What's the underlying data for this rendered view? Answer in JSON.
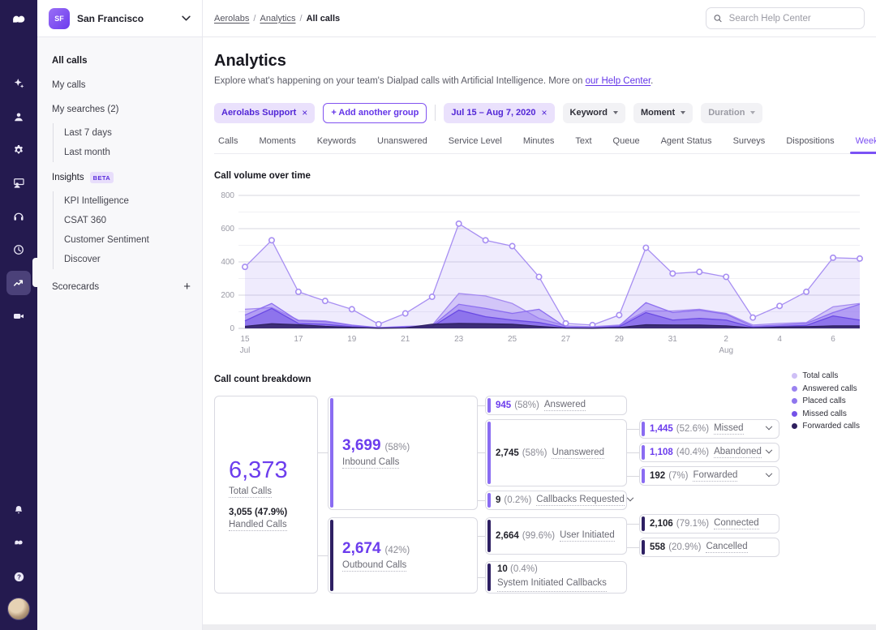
{
  "topbar": {
    "team_name": "San Francisco",
    "team_initials": "SF",
    "breadcrumb": [
      "Aerolabs",
      "Analytics",
      "All calls"
    ],
    "search_placeholder": "Search Help Center"
  },
  "rail": {
    "help_glyph": "?"
  },
  "sidebar": {
    "items_top": [
      "All calls",
      "My calls",
      "My searches (2)"
    ],
    "searches": [
      "Last 7 days",
      "Last month"
    ],
    "insights_label": "Insights",
    "beta_badge": "BETA",
    "insights_items": [
      "KPI Intelligence",
      "CSAT 360",
      "Customer Sentiment",
      "Discover"
    ],
    "scorecards_label": "Scorecards",
    "add_icon": "+"
  },
  "header": {
    "title": "Analytics",
    "description": "Explore what's happening on your team's Dialpad calls with Artificial Intelligence. More on",
    "link_text": "our Help Center",
    "period": "."
  },
  "filters": {
    "group_chip": "Aerolabs Support",
    "close": "×",
    "add_group": "+ Add another group",
    "date_chip": "Jul 15 – Aug 7, 2020",
    "keyword": "Keyword",
    "moment": "Moment",
    "duration": "Duration"
  },
  "tabs": {
    "items": [
      "Calls",
      "Moments",
      "Keywords",
      "Unanswered",
      "Service Level",
      "Minutes",
      "Text",
      "Queue",
      "Agent Status",
      "Surveys",
      "Dispositions",
      "Weekly Averages"
    ],
    "active": "Weekly Averages"
  },
  "chart_section": {
    "title": "Call volume over time"
  },
  "chart_data": {
    "type": "area",
    "title": "Call volume over time",
    "x": [
      15,
      16,
      17,
      18,
      19,
      20,
      21,
      22,
      23,
      24,
      25,
      26,
      27,
      28,
      29,
      30,
      31,
      1,
      2,
      3,
      4,
      5,
      6,
      7
    ],
    "month_labels": [
      {
        "index": 0,
        "label": "Jul"
      },
      {
        "index": 18,
        "label": "Aug"
      }
    ],
    "ylim": [
      0,
      800
    ],
    "yticks": [
      0,
      200,
      400,
      600,
      800
    ],
    "grid_step": 100,
    "legend_position": "right-of-breakdown",
    "series": [
      {
        "name": "Total calls",
        "color": "#a78ef2",
        "fill_opacity": 0.18,
        "markers": true,
        "values": [
          370,
          530,
          220,
          165,
          115,
          25,
          90,
          190,
          630,
          530,
          495,
          310,
          30,
          20,
          80,
          485,
          330,
          340,
          310,
          65,
          135,
          220,
          425,
          420
        ]
      },
      {
        "name": "Placed calls",
        "color": "#a48af0",
        "fill_opacity": 0.38,
        "markers": false,
        "values": [
          115,
          125,
          50,
          45,
          20,
          5,
          12,
          18,
          210,
          195,
          150,
          60,
          15,
          10,
          20,
          105,
          105,
          115,
          90,
          20,
          30,
          35,
          130,
          150
        ]
      },
      {
        "name": "Answered calls",
        "color": "#8d6ff0",
        "fill_opacity": 0.45,
        "markers": false,
        "values": [
          80,
          150,
          45,
          40,
          18,
          4,
          10,
          15,
          145,
          120,
          90,
          115,
          8,
          5,
          15,
          155,
          95,
          110,
          85,
          12,
          20,
          30,
          95,
          145
        ]
      },
      {
        "name": "Missed calls",
        "color": "#6a4ae4",
        "fill_opacity": 0.5,
        "markers": false,
        "values": [
          45,
          120,
          30,
          25,
          10,
          2,
          6,
          10,
          110,
          70,
          50,
          35,
          5,
          3,
          10,
          95,
          50,
          60,
          50,
          6,
          12,
          18,
          75,
          50
        ]
      },
      {
        "name": "Forwarded calls",
        "color": "#2e2063",
        "fill_opacity": 0.85,
        "markers": false,
        "values": [
          12,
          28,
          22,
          12,
          6,
          1,
          3,
          25,
          30,
          28,
          25,
          12,
          2,
          1,
          5,
          22,
          20,
          20,
          15,
          3,
          8,
          10,
          15,
          15
        ]
      }
    ]
  },
  "legend": {
    "items": [
      {
        "label": "Total calls",
        "color": "#cfc0f6"
      },
      {
        "label": "Answered calls",
        "color": "#9b83f0"
      },
      {
        "label": "Placed calls",
        "color": "#8f76ee"
      },
      {
        "label": "Missed calls",
        "color": "#7452e8"
      },
      {
        "label": "Forwarded calls",
        "color": "#2e1f5e"
      }
    ]
  },
  "breakdown": {
    "title": "Call count breakdown",
    "total": {
      "value": "6,373",
      "label": "Total Calls",
      "sub_value": "3,055 (47.9%)",
      "sub_label": "Handled Calls"
    },
    "inbound": {
      "value": "3,699",
      "pct": "(58%)",
      "label": "Inbound Calls"
    },
    "outbound": {
      "value": "2,674",
      "pct": "(42%)",
      "label": "Outbound Calls"
    },
    "answered": {
      "value": "945",
      "pct": "(58%)",
      "label": "Answered"
    },
    "unanswered": {
      "value": "2,745",
      "pct": "(58%)",
      "label": "Unanswered"
    },
    "callbacks": {
      "value": "9",
      "pct": "(0.2%)",
      "label": "Callbacks Requested"
    },
    "missed": {
      "value": "1,445",
      "pct": "(52.6%)",
      "label": "Missed"
    },
    "abandoned": {
      "value": "1,108",
      "pct": "(40.4%)",
      "label": "Abandoned"
    },
    "forwarded": {
      "value": "192",
      "pct": "(7%)",
      "label": "Forwarded"
    },
    "user_initiated": {
      "value": "2,664",
      "pct": "(99.6%)",
      "label": "User Initiated"
    },
    "system_initiated": {
      "value": "10",
      "pct": "(0.4%)",
      "label": "System Initiated Callbacks"
    },
    "connected": {
      "value": "2,106",
      "pct": "(79.1%)",
      "label": "Connected"
    },
    "cancelled": {
      "value": "558",
      "pct": "(20.9%)",
      "label": "Cancelled"
    }
  }
}
